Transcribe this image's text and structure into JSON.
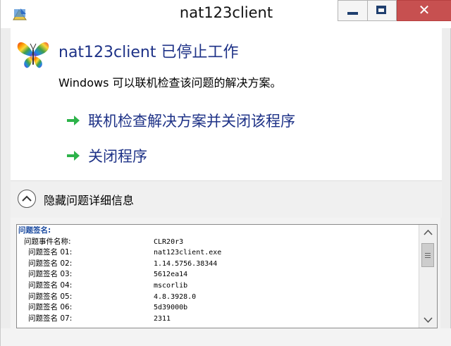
{
  "window": {
    "title": "nat123client",
    "minimize_icon": "minimize-icon",
    "maximize_icon": "maximize-icon",
    "close_symbol": "✕"
  },
  "dialog": {
    "heading": "nat123client 已停止工作",
    "subtext": "Windows 可以联机检查该问题的解决方案。",
    "options": [
      {
        "label": "联机检查解决方案并关闭该程序",
        "icon": "green-arrow-icon"
      },
      {
        "label": "关闭程序",
        "icon": "green-arrow-icon"
      }
    ],
    "details_toggle": "隐藏问题详细信息"
  },
  "details": {
    "header": "问题签名:",
    "rows": [
      {
        "key": "问题事件名称:",
        "value": "CLR20r3"
      },
      {
        "key": "问题签名 01:",
        "value": "nat123client.exe"
      },
      {
        "key": "问题签名 02:",
        "value": "1.14.5756.38344"
      },
      {
        "key": "问题签名 03:",
        "value": "5612ea14"
      },
      {
        "key": "问题签名 04:",
        "value": "mscorlib"
      },
      {
        "key": "问题签名 05:",
        "value": "4.8.3928.0"
      },
      {
        "key": "问题签名 06:",
        "value": "5d39000b"
      },
      {
        "key": "问题签名 07:",
        "value": "2311"
      }
    ]
  },
  "colors": {
    "accent_text": "#1e3287",
    "close_button": "#c75050",
    "arrow_green": "#2db34a"
  }
}
